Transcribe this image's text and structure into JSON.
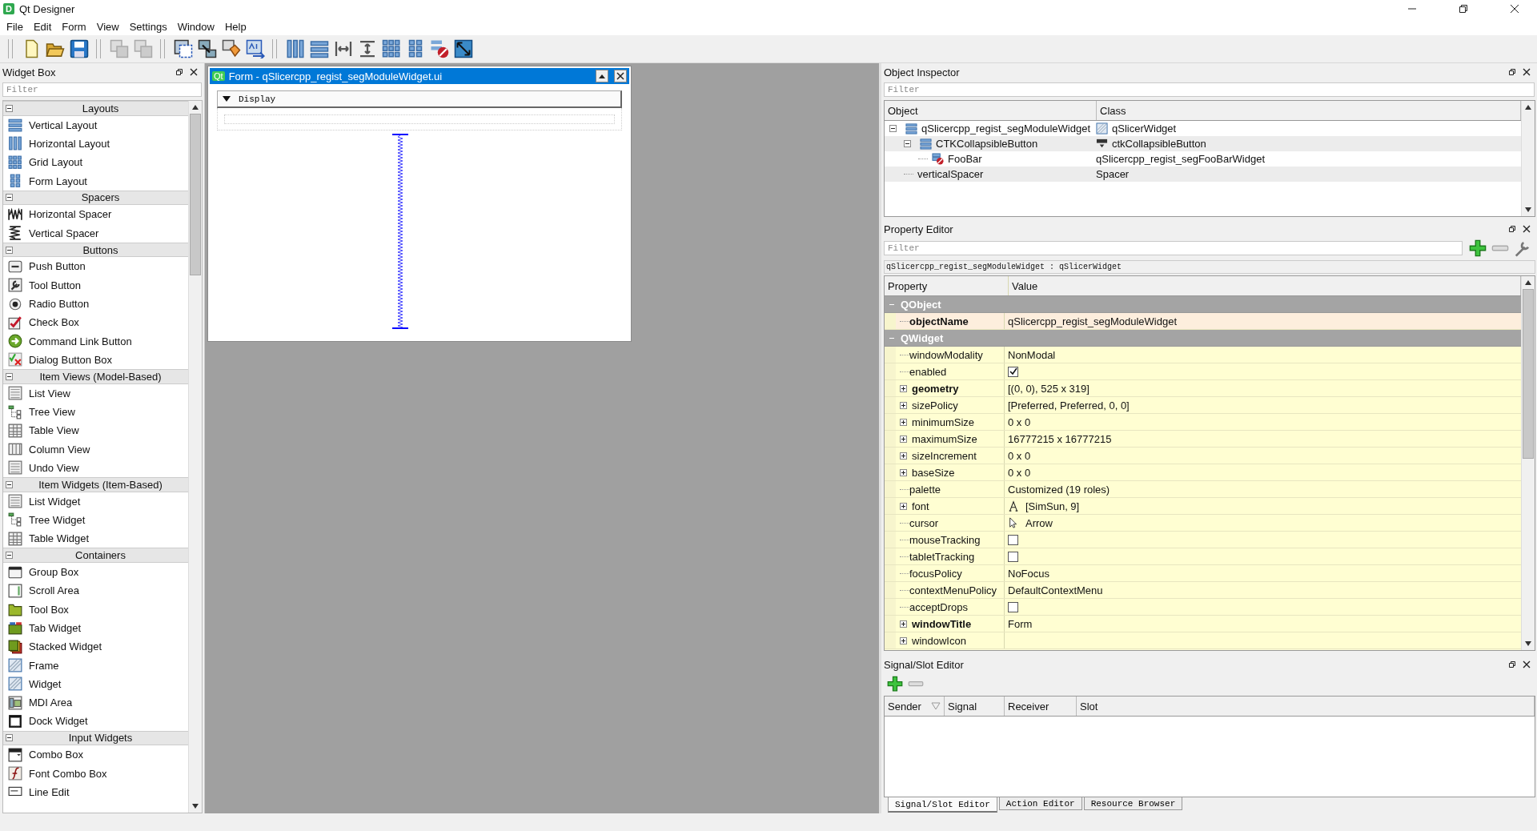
{
  "window": {
    "icon_text": "D",
    "title": "Qt Designer"
  },
  "menu": [
    "File",
    "Edit",
    "Form",
    "View",
    "Settings",
    "Window",
    "Help"
  ],
  "widget_box": {
    "title": "Widget Box",
    "filter_placeholder": "Filter",
    "categories": [
      {
        "name": "Layouts",
        "expanded": true,
        "items": [
          "Vertical Layout",
          "Horizontal Layout",
          "Grid Layout",
          "Form Layout"
        ]
      },
      {
        "name": "Spacers",
        "expanded": true,
        "items": [
          "Horizontal Spacer",
          "Vertical Spacer"
        ]
      },
      {
        "name": "Buttons",
        "expanded": true,
        "items": [
          "Push Button",
          "Tool Button",
          "Radio Button",
          "Check Box",
          "Command Link Button",
          "Dialog Button Box"
        ]
      },
      {
        "name": "Item Views (Model-Based)",
        "expanded": true,
        "items": [
          "List View",
          "Tree View",
          "Table View",
          "Column View",
          "Undo View"
        ]
      },
      {
        "name": "Item Widgets (Item-Based)",
        "expanded": true,
        "items": [
          "List Widget",
          "Tree Widget",
          "Table Widget"
        ]
      },
      {
        "name": "Containers",
        "expanded": true,
        "items": [
          "Group Box",
          "Scroll Area",
          "Tool Box",
          "Tab Widget",
          "Stacked Widget",
          "Frame",
          "Widget",
          "MDI Area",
          "Dock Widget"
        ]
      },
      {
        "name": "Input Widgets",
        "expanded": true,
        "items": [
          "Combo Box",
          "Font Combo Box",
          "Line Edit"
        ]
      }
    ]
  },
  "form_window": {
    "icon_text": "Qt",
    "title": "Form - qSlicercpp_regist_segModuleWidget.ui",
    "collapsible": {
      "label": "Display",
      "expanded": true
    }
  },
  "object_inspector": {
    "title": "Object Inspector",
    "filter_placeholder": "Filter",
    "columns": [
      "Object",
      "Class"
    ],
    "objects": [
      {
        "object": "qSlicercpp_regist_segModuleWidget",
        "class": "qSlicerWidget",
        "expanded": true,
        "children": [
          {
            "object": "CTKCollapsibleButton",
            "class": "ctkCollapsibleButton",
            "expanded": true,
            "children": [
              {
                "object": "FooBar",
                "class": "qSlicercpp_regist_segFooBarWidget"
              }
            ]
          },
          {
            "object": "verticalSpacer",
            "class": "Spacer"
          }
        ]
      }
    ]
  },
  "property_editor": {
    "title": "Property Editor",
    "filter_placeholder": "Filter",
    "object_label": "qSlicercpp_regist_segModuleWidget : qSlicerWidget",
    "columns": [
      "Property",
      "Value"
    ],
    "rows": [
      {
        "kind": "group",
        "name": "QObject",
        "expanded": true
      },
      {
        "kind": "text",
        "name": "objectName",
        "bold": true,
        "selected": true,
        "value": "qSlicercpp_regist_segModuleWidget"
      },
      {
        "kind": "group",
        "name": "QWidget",
        "expanded": true
      },
      {
        "kind": "text",
        "name": "windowModality",
        "bold": false,
        "selected": false,
        "value": "NonModal"
      },
      {
        "kind": "check",
        "name": "enabled",
        "bold": false,
        "selected": false,
        "checked": true
      },
      {
        "kind": "text",
        "name": "geometry",
        "bold": true,
        "selected": false,
        "expanded": false,
        "value": "[(0, 0), 525 x 319]"
      },
      {
        "kind": "text",
        "name": "sizePolicy",
        "bold": false,
        "selected": false,
        "expanded": false,
        "value": "[Preferred, Preferred, 0, 0]"
      },
      {
        "kind": "text",
        "name": "minimumSize",
        "bold": false,
        "selected": false,
        "expanded": false,
        "value": "0 x 0"
      },
      {
        "kind": "text",
        "name": "maximumSize",
        "bold": false,
        "selected": false,
        "expanded": false,
        "value": "16777215 x 16777215"
      },
      {
        "kind": "text",
        "name": "sizeIncrement",
        "bold": false,
        "selected": false,
        "expanded": false,
        "value": "0 x 0"
      },
      {
        "kind": "text",
        "name": "baseSize",
        "bold": false,
        "selected": false,
        "expanded": false,
        "value": "0 x 0"
      },
      {
        "kind": "text",
        "name": "palette",
        "bold": false,
        "selected": false,
        "value": "Customized (19 roles)"
      },
      {
        "kind": "font",
        "name": "font",
        "bold": false,
        "selected": false,
        "expanded": false,
        "value": "[SimSun, 9]"
      },
      {
        "kind": "cursor",
        "name": "cursor",
        "bold": false,
        "selected": false,
        "value": "Arrow"
      },
      {
        "kind": "check",
        "name": "mouseTracking",
        "bold": false,
        "selected": false,
        "checked": false
      },
      {
        "kind": "check",
        "name": "tabletTracking",
        "bold": false,
        "selected": false,
        "checked": false
      },
      {
        "kind": "text",
        "name": "focusPolicy",
        "bold": false,
        "selected": false,
        "value": "NoFocus"
      },
      {
        "kind": "text",
        "name": "contextMenuPolicy",
        "bold": false,
        "selected": false,
        "value": "DefaultContextMenu"
      },
      {
        "kind": "check",
        "name": "acceptDrops",
        "bold": false,
        "selected": false,
        "checked": false
      },
      {
        "kind": "text",
        "name": "windowTitle",
        "bold": true,
        "selected": false,
        "expanded": false,
        "value": "Form"
      },
      {
        "kind": "text",
        "name": "windowIcon",
        "bold": false,
        "selected": false,
        "expanded": false
      }
    ]
  },
  "signal_slot_editor": {
    "title": "Signal/Slot Editor",
    "columns": [
      "Sender",
      "Signal",
      "Receiver",
      "Slot"
    ]
  },
  "bottom_tabs": [
    {
      "label": "Signal/Slot Editor",
      "selected": true
    },
    {
      "label": "Action Editor",
      "selected": false
    },
    {
      "label": "Resource Browser",
      "selected": false
    }
  ]
}
